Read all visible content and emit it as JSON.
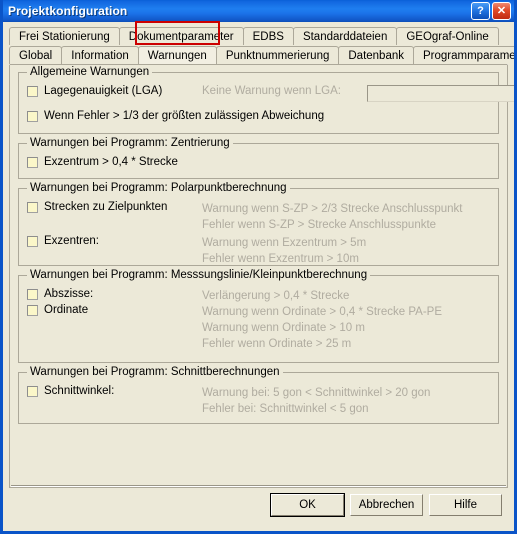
{
  "window": {
    "title": "Projektkonfiguration",
    "help_button": "?",
    "close_button": "✕",
    "accent_color": "#1f7ef0",
    "face_color": "#ece9d8",
    "highlight_color": "#cc0000",
    "disabled_text_color": "#b0aca0",
    "checkbox_fill": "#fbf7c9"
  },
  "tabs": {
    "row1": [
      {
        "label": "Frei Stationierung",
        "selected": false
      },
      {
        "label": "Dokumentparameter",
        "selected": false
      },
      {
        "label": "EDBS",
        "selected": false
      },
      {
        "label": "Standarddateien",
        "selected": false
      },
      {
        "label": "GEOgraf-Online",
        "selected": false
      }
    ],
    "row2": [
      {
        "label": "Global",
        "selected": false
      },
      {
        "label": "Information",
        "selected": false
      },
      {
        "label": "Warnungen",
        "selected": true
      },
      {
        "label": "Punktnummerierung",
        "selected": false
      },
      {
        "label": "Datenbank",
        "selected": false
      },
      {
        "label": "Programmparameter",
        "selected": false
      }
    ]
  },
  "groups": [
    {
      "legend": "Allgemeine Warnungen",
      "rows": [
        {
          "checkbox_label": "Lagegenauigkeit (LGA)",
          "checked": false,
          "side_label": "Keine Warnung wenn LGA:",
          "side_label_disabled": true,
          "field_value": "",
          "field_placeholder": ""
        },
        {
          "checkbox_label": "Wenn Fehler > 1/3 der größten zulässigen Abweichung",
          "checked": false
        }
      ]
    },
    {
      "legend": "Warnungen bei Programm: Zentrierung",
      "rows": [
        {
          "checkbox_label": "Exzentrum > 0,4 * Strecke",
          "checked": false
        }
      ]
    },
    {
      "legend": "Warnungen bei Programm: Polarpunktberechnung",
      "rows": [
        {
          "checkbox_label": "Strecken zu Zielpunkten",
          "checked": false,
          "hints": [
            "Warnung wenn S-ZP > 2/3 Strecke Anschlusspunkt",
            "Fehler wenn S-ZP > Strecke Anschlusspunkte"
          ]
        },
        {
          "checkbox_label": "Exzentren:",
          "checked": false,
          "hints": [
            "Warnung wenn Exzentrum > 5m",
            "Fehler wenn Exzentrum > 10m"
          ]
        }
      ]
    },
    {
      "legend": "Warnungen bei Programm: Messsungslinie/Kleinpunktberechnung",
      "rows": [
        {
          "checkbox_label": "Abszisse:",
          "checked": false,
          "hints": [
            "Verlängerung > 0,4 * Strecke"
          ]
        },
        {
          "checkbox_label": "Ordinate",
          "checked": false,
          "hints": [
            "Warnung wenn Ordinate > 0,4 * Strecke PA-PE",
            "Warnung wenn Ordinate > 10 m",
            "Fehler wenn Ordinate > 25 m"
          ]
        }
      ]
    },
    {
      "legend": "Warnungen bei Programm: Schnittberechnungen",
      "rows": [
        {
          "checkbox_label": "Schnittwinkel:",
          "checked": false,
          "hints": [
            "Warnung bei: 5 gon < Schnittwinkel > 20 gon",
            "Fehler bei:  Schnittwinkel < 5 gon"
          ]
        }
      ]
    }
  ],
  "footer": {
    "buttons": [
      {
        "label": "OK",
        "default": true
      },
      {
        "label": "Abbrechen",
        "default": false
      },
      {
        "label": "Hilfe",
        "default": false
      }
    ]
  }
}
